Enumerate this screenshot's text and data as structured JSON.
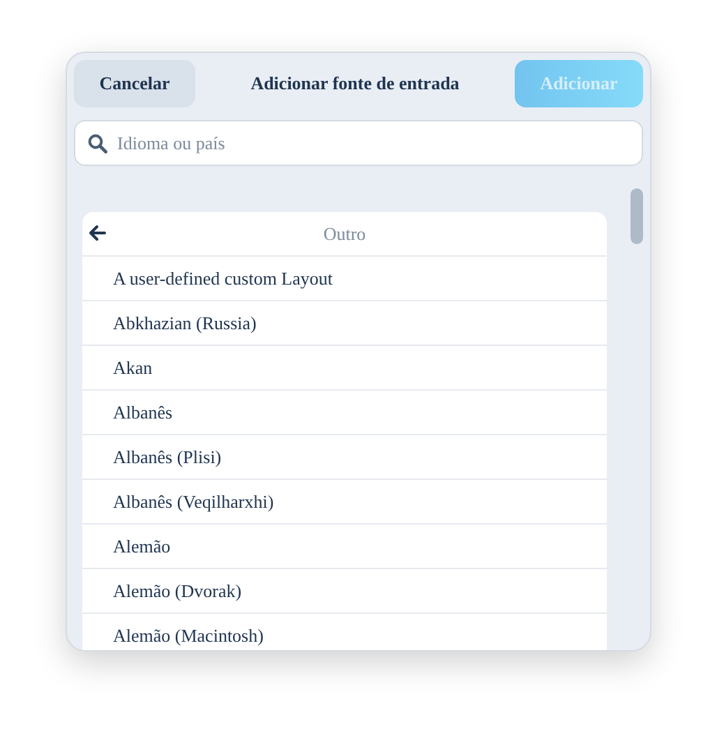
{
  "dialog": {
    "title": "Adicionar fonte de entrada",
    "cancel_button": {
      "label": "Cancelar"
    },
    "add_button": {
      "label": "Adicionar",
      "disabled": true
    },
    "search": {
      "placeholder": "Idioma ou país"
    },
    "list": {
      "header": "Outro",
      "items": [
        {
          "label": "A user-defined custom Layout"
        },
        {
          "label": "Abkhazian (Russia)"
        },
        {
          "label": "Akan"
        },
        {
          "label": "Albanês"
        },
        {
          "label": "Albanês (Plisi)"
        },
        {
          "label": "Albanês (Veqilharxhi)"
        },
        {
          "label": "Alemão"
        },
        {
          "label": "Alemão (Dvorak)"
        },
        {
          "label": "Alemão (Macintosh)"
        }
      ]
    }
  }
}
